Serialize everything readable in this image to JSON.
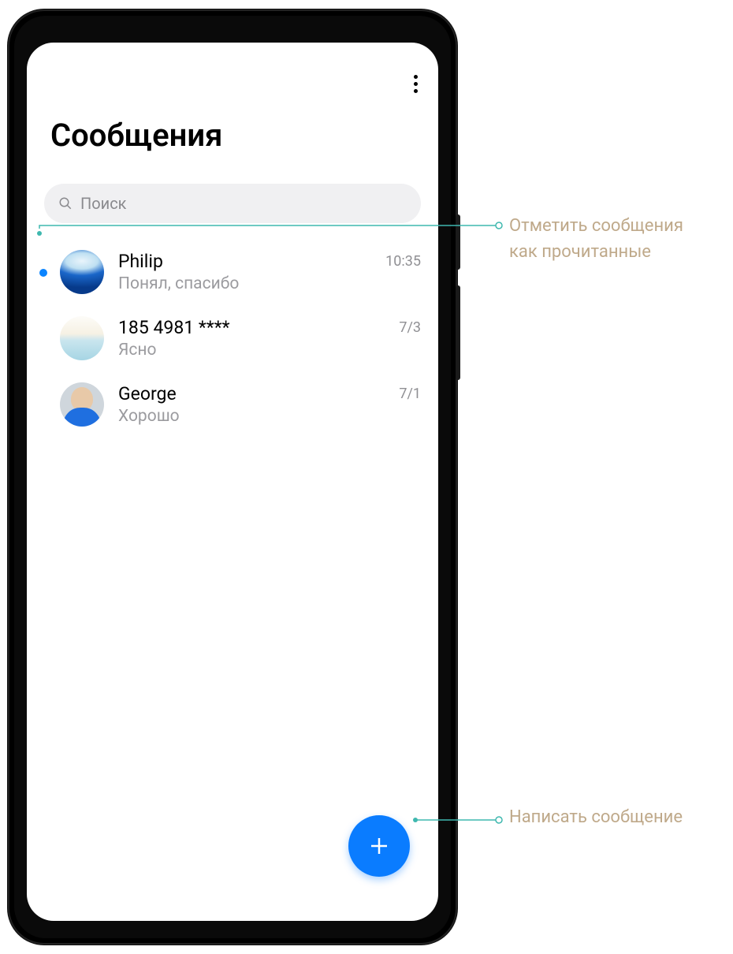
{
  "header": {
    "title": "Сообщения"
  },
  "search": {
    "placeholder": "Поиск"
  },
  "conversations": [
    {
      "name": "Philip",
      "preview": "Понял, спасибо",
      "time": "10:35",
      "unread": true,
      "avatar": "ocean"
    },
    {
      "name": "185 4981 ****",
      "preview": "Ясно",
      "time": "7/3",
      "unread": false,
      "avatar": "beach"
    },
    {
      "name": "George",
      "preview": "Хорошо",
      "time": "7/1",
      "unread": false,
      "avatar": "person"
    }
  ],
  "callouts": {
    "mark_read": "Отметить сообщения как прочитанные",
    "compose": "Написать сообщение"
  },
  "colors": {
    "accent": "#0a7cff",
    "leader": "#3fb8af",
    "callout_text": "#bfa98a"
  }
}
